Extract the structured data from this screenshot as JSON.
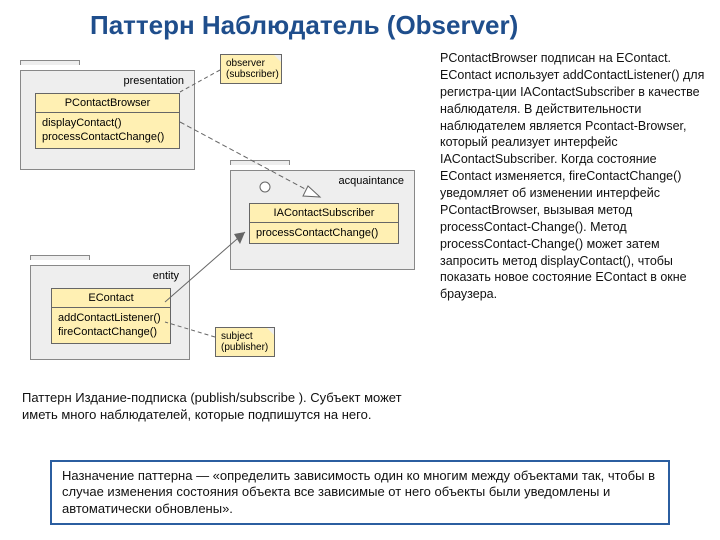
{
  "title": "Паттерн Наблюдатель (Observer)",
  "packages": {
    "presentation": {
      "label": "presentation"
    },
    "acquaintance": {
      "label": "acquaintance"
    },
    "entity": {
      "label": "entity"
    }
  },
  "classes": {
    "pcontact": {
      "name": "PContactBrowser",
      "ops": "displayContact()\nprocessContactChange()"
    },
    "iacontact": {
      "name": "IAContactSubscriber",
      "ops": "processContactChange()"
    },
    "econtact": {
      "name": "EContact",
      "ops": "addContactListener()\nfireContactChange()"
    }
  },
  "notes": {
    "observer": {
      "line1": "observer",
      "line2": "(subscriber)"
    },
    "subject": {
      "line1": "subject",
      "line2": "(publisher)"
    }
  },
  "right_text": "PContactBrowser подписан на EContact. EContact использует addContactListener() для регистра-ции IAContactSubscriber в качестве наблюдателя. В действительности наблюдателем является Pcontact-Browser, который реализует интерфейс IAContactSubscriber. Когда состояние EContact изменяется, fireContactChange() уведомляет об изменении интерфейс PContactBrowser, вызывая метод processContact-Change(). Метод processContact-Change() может затем запросить метод displayContact(), чтобы показать новое состояние EContact в окне браузера.",
  "caption": "Паттерн Издание-подписка (publish/subscribe ). Субъект может иметь много наблюдателей, которые подпишутся на него.",
  "bottom": "     Назначение паттерна — «определить зависимость один ко многим между объектами так, чтобы в случае изменения состояния объекта все зависимые от него объекты были уведомлены и автоматически обновлены»."
}
